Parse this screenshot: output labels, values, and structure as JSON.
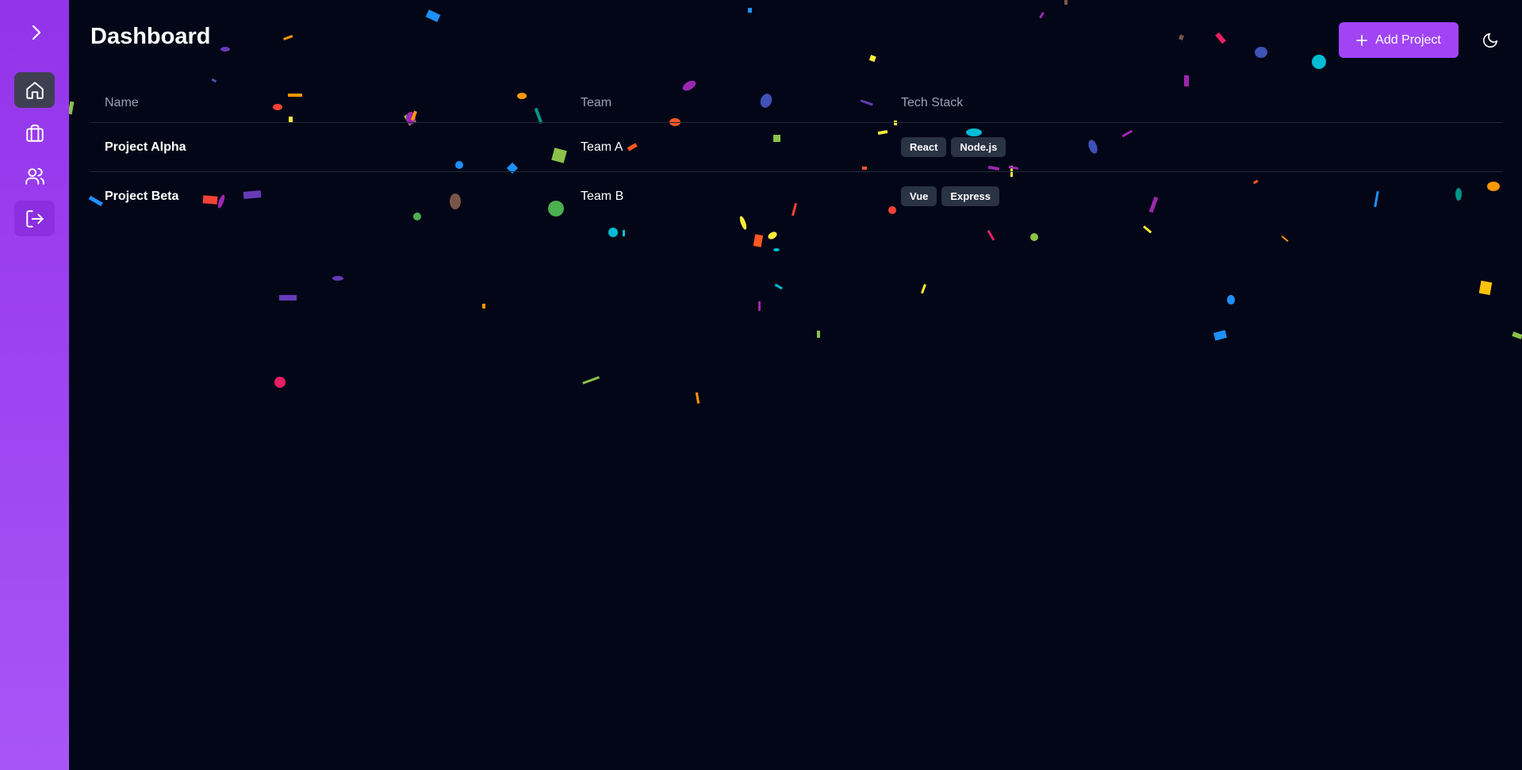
{
  "sidebar": {
    "toggle_icon": "chevron-right-icon",
    "nav": [
      {
        "id": "home",
        "icon": "home-icon",
        "active": true
      },
      {
        "id": "projects",
        "icon": "briefcase-icon",
        "active": false
      },
      {
        "id": "team",
        "icon": "users-icon",
        "active": false
      },
      {
        "id": "logout",
        "icon": "log-out-icon",
        "active": false
      }
    ]
  },
  "header": {
    "title": "Dashboard",
    "add_button_label": "Add Project",
    "theme_icon": "moon-icon"
  },
  "table": {
    "columns": [
      "Name",
      "Team",
      "Tech Stack"
    ],
    "rows": [
      {
        "name": "Project Alpha",
        "team": "Team A",
        "tech": [
          "React",
          "Node.js"
        ]
      },
      {
        "name": "Project Beta",
        "team": "Team B",
        "tech": [
          "Vue",
          "Express"
        ]
      }
    ]
  },
  "colors": {
    "background": "#030617",
    "sidebar_top": "#9333ea",
    "sidebar_bottom": "#a855f7",
    "accent": "#a144f5",
    "badge": "#2a3343"
  }
}
